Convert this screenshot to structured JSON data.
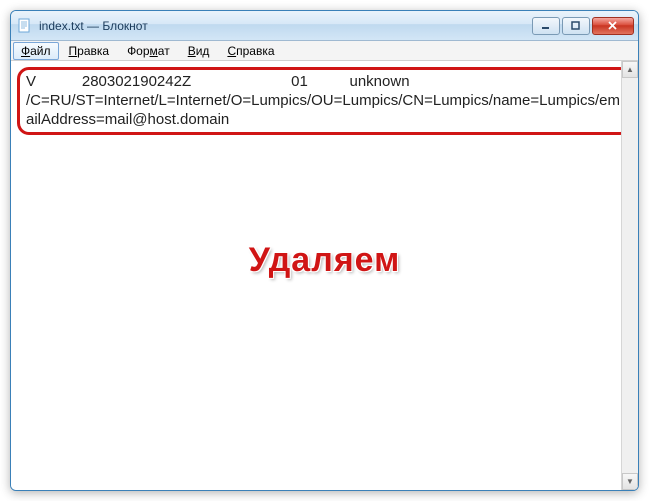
{
  "window": {
    "title": "index.txt — Блокнот"
  },
  "menu": {
    "file": "Файл",
    "edit": "Правка",
    "format": "Формат",
    "view": "Вид",
    "help": "Справка"
  },
  "content": {
    "line1": "V           280302190242Z                        01          unknown",
    "line2": "/C=RU/ST=Internet/L=Internet/O=Lumpics/OU=Lumpics/CN=Lumpics/name=Lumpics/emailAddress=mail@host.domain"
  },
  "annotation": {
    "text": "Удаляем"
  }
}
